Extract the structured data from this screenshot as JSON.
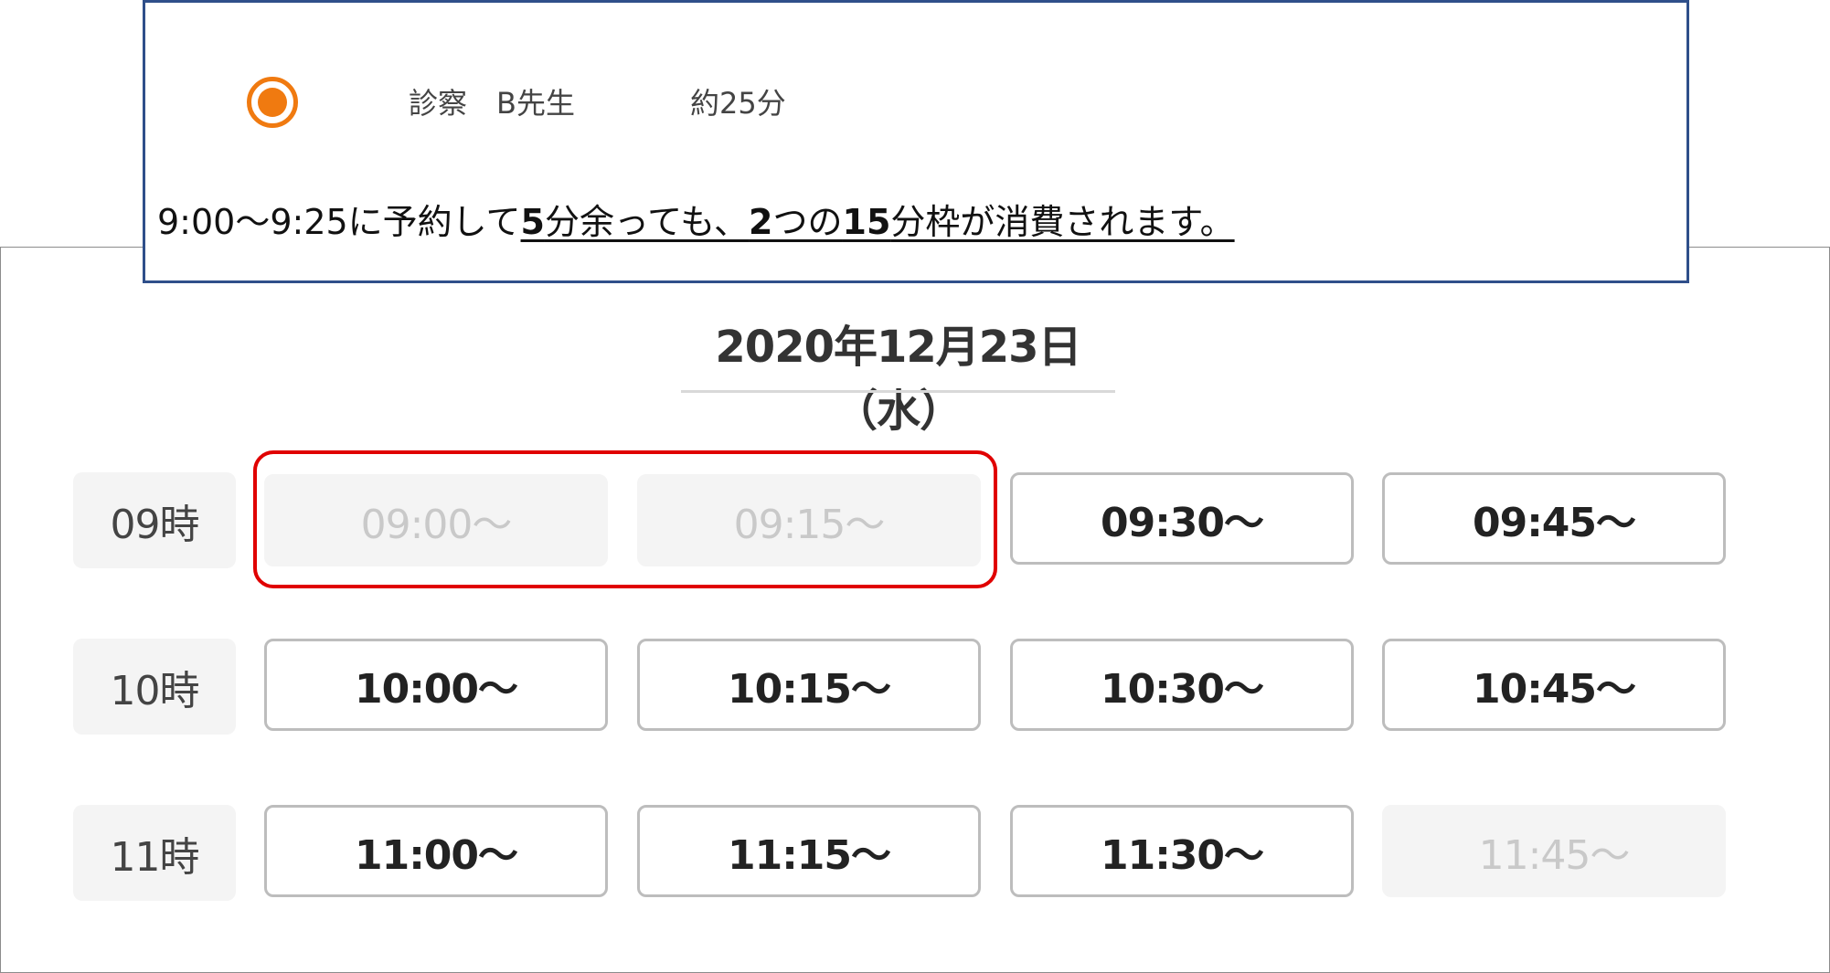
{
  "callout": {
    "service_name": "診察　B先生",
    "service_duration": "約25分",
    "note_plain": "9:00〜9:25に予約して",
    "note_parts": [
      {
        "text": "5",
        "bold": true
      },
      {
        "text": "分余っても、",
        "bold": false
      },
      {
        "text": "2",
        "bold": true
      },
      {
        "text": "つの",
        "bold": false
      },
      {
        "text": "15",
        "bold": true
      },
      {
        "text": "分枠が消費されます。",
        "bold": false
      }
    ],
    "accent_color": "#f07a10",
    "border_color": "#2f4f8a"
  },
  "schedule": {
    "date": "2020年12月23日（水）",
    "highlight_color": "#e00000",
    "rows": [
      {
        "hour": "09時",
        "slots": [
          {
            "label": "09:00〜",
            "available": false
          },
          {
            "label": "09:15〜",
            "available": false
          },
          {
            "label": "09:30〜",
            "available": true
          },
          {
            "label": "09:45〜",
            "available": true
          }
        ]
      },
      {
        "hour": "10時",
        "slots": [
          {
            "label": "10:00〜",
            "available": true
          },
          {
            "label": "10:15〜",
            "available": true
          },
          {
            "label": "10:30〜",
            "available": true
          },
          {
            "label": "10:45〜",
            "available": true
          }
        ]
      },
      {
        "hour": "11時",
        "slots": [
          {
            "label": "11:00〜",
            "available": true
          },
          {
            "label": "11:15〜",
            "available": true
          },
          {
            "label": "11:30〜",
            "available": true
          },
          {
            "label": "11:45〜",
            "available": false
          }
        ]
      }
    ]
  }
}
